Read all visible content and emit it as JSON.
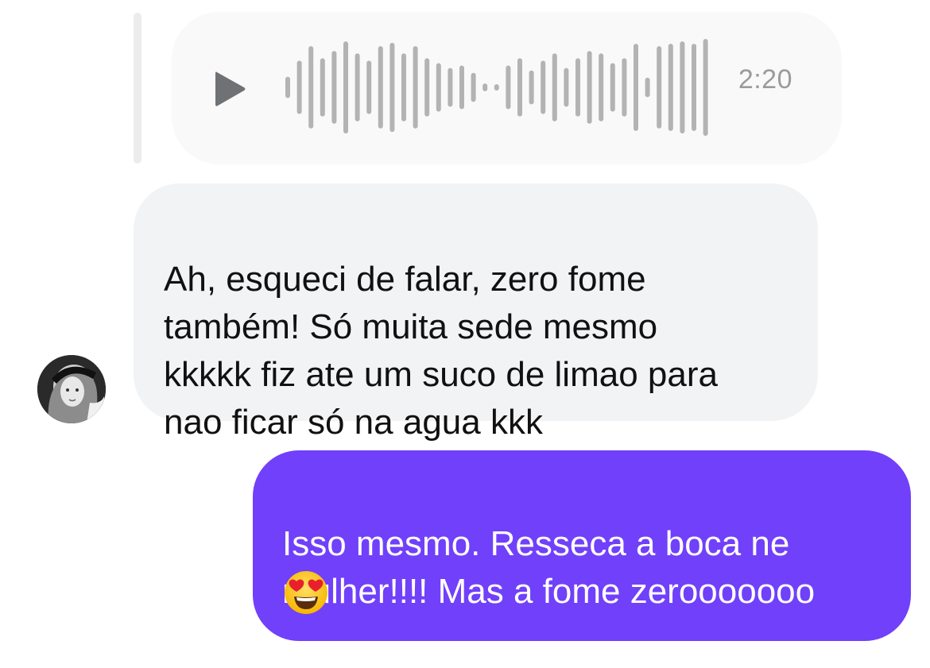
{
  "audio_message": {
    "duration": "2:20",
    "play_icon": "play-icon",
    "waveform_levels": [
      0.22,
      0.55,
      0.85,
      0.6,
      0.75,
      0.95,
      0.7,
      0.55,
      0.85,
      0.92,
      0.7,
      0.85,
      0.6,
      0.5,
      0.4,
      0.45,
      0.3,
      0.08,
      0.06,
      0.45,
      0.6,
      0.35,
      0.55,
      0.7,
      0.4,
      0.6,
      0.75,
      0.7,
      0.5,
      0.6,
      0.9,
      0.2,
      0.85,
      0.9,
      0.95,
      0.9,
      1.0
    ]
  },
  "incoming_message": {
    "text": "Ah, esqueci de falar, zero fome\ntambém! Só muita sede mesmo\nkkkkk fiz ate um suco de limao para\nnao ficar só na agua kkk",
    "avatar_icon": "profile-avatar"
  },
  "outgoing_message": {
    "text": "Isso mesmo. Resseca a boca ne\nmulher!!!! Mas a fome zerooooooo",
    "emoji_icon": "heart-eyes-emoji"
  },
  "colors": {
    "outgoing_bubble": "#7140fa",
    "incoming_bubble": "#f2f3f5",
    "audio_bubble": "#f9f9f9",
    "waveform": "#b3b3b3",
    "play_icon": "#6f7275",
    "duration_text": "#9b9b9b"
  }
}
